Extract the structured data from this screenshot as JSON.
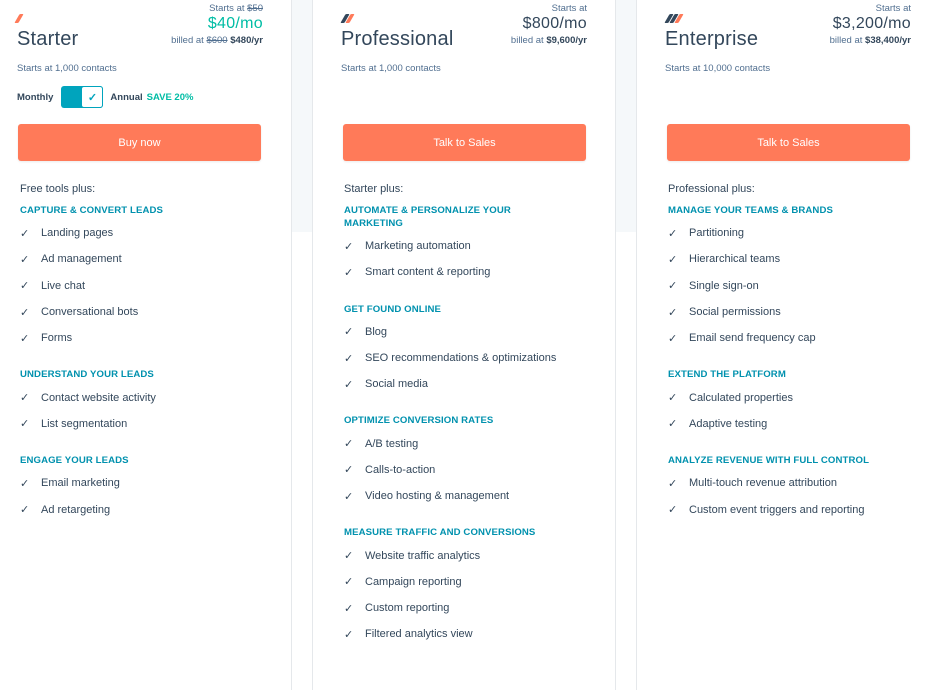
{
  "plans": [
    {
      "id": "starter",
      "name": "Starter",
      "contacts": "Starts at 1,000 contacts",
      "starts_at_label": "Starts at",
      "starts_at_old": "$50",
      "price": "$40/mo",
      "billed_label": "billed at",
      "billed_old": "$600",
      "billed": "$480/yr",
      "toggle": {
        "left_label": "Monthly",
        "right_label": "Annual",
        "save_label": "SAVE 20%",
        "state": "annual"
      },
      "cta": "Buy now",
      "plus_label": "Free tools plus:",
      "sections": [
        {
          "title": "CAPTURE & CONVERT LEADS",
          "items": [
            "Landing pages",
            "Ad management",
            "Live chat",
            "Conversational bots",
            "Forms"
          ]
        },
        {
          "title": "UNDERSTAND YOUR LEADS",
          "items": [
            "Contact website activity",
            "List segmentation"
          ]
        },
        {
          "title": "ENGAGE YOUR LEADS",
          "items": [
            "Email marketing",
            "Ad retargeting"
          ]
        }
      ]
    },
    {
      "id": "professional",
      "name": "Professional",
      "contacts": "Starts at 1,000 contacts",
      "starts_at_label": "Starts at",
      "price": "$800/mo",
      "billed_label": "billed at",
      "billed": "$9,600/yr",
      "cta": "Talk to Sales",
      "plus_label": "Starter plus:",
      "sections": [
        {
          "title": "AUTOMATE & PERSONALIZE YOUR MARKETING",
          "items": [
            "Marketing automation",
            "Smart content & reporting"
          ]
        },
        {
          "title": "GET FOUND ONLINE",
          "items": [
            "Blog",
            "SEO recommendations & optimizations",
            "Social media"
          ]
        },
        {
          "title": "OPTIMIZE CONVERSION RATES",
          "items": [
            "A/B testing",
            "Calls-to-action",
            "Video hosting & management"
          ]
        },
        {
          "title": "MEASURE TRAFFIC AND CONVERSIONS",
          "items": [
            "Website traffic analytics",
            "Campaign reporting",
            "Custom reporting",
            "Filtered analytics view"
          ]
        }
      ]
    },
    {
      "id": "enterprise",
      "name": "Enterprise",
      "contacts": "Starts at 10,000 contacts",
      "starts_at_label": "Starts at",
      "price": "$3,200/mo",
      "billed_label": "billed at",
      "billed": "$38,400/yr",
      "cta": "Talk to Sales",
      "plus_label": "Professional plus:",
      "sections": [
        {
          "title": "MANAGE YOUR TEAMS & BRANDS",
          "items": [
            "Partitioning",
            "Hierarchical teams",
            "Single sign-on",
            "Social permissions",
            "Email send frequency cap"
          ]
        },
        {
          "title": "EXTEND THE PLATFORM",
          "items": [
            "Calculated properties",
            "Adaptive testing"
          ]
        },
        {
          "title": "ANALYZE REVENUE WITH FULL CONTROL",
          "items": [
            "Multi-touch revenue attribution",
            "Custom event triggers and reporting"
          ]
        }
      ]
    }
  ],
  "icons": {
    "check": "✓",
    "plan_sprocket": "sprocket-icon"
  },
  "colors": {
    "cta": "#ff7a59",
    "accent_teal": "#00a4bd",
    "section_title": "#0091ae",
    "price_green": "#00bda5",
    "text": "#33475b"
  }
}
